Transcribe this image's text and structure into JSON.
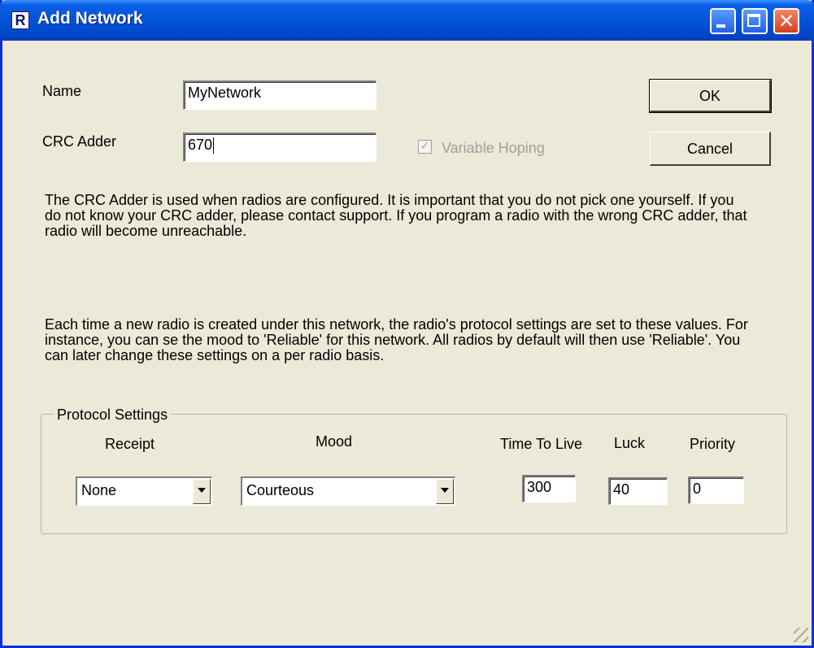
{
  "window": {
    "title": "Add Network",
    "icon_letter": "R"
  },
  "fields": {
    "name_label": "Name",
    "name_value": "MyNetwork",
    "crc_label": "CRC Adder",
    "crc_value": "670",
    "variable_hoping_label": "Variable Hoping",
    "variable_hoping_checked": true,
    "variable_hoping_enabled": false
  },
  "buttons": {
    "ok": "OK",
    "cancel": "Cancel"
  },
  "help": {
    "crc_paragraph": "The CRC Adder is used when radios are configured. It is important that you do not pick one yourself. If you do not know your CRC adder, please contact support. If you program a radio with the wrong CRC adder, that radio will become unreachable.",
    "protocol_paragraph": "Each time a new radio is created under this network, the radio's protocol settings are set to these values. For instance, you can se the mood to 'Reliable' for this network. All radios by default will then use 'Reliable'. You can later change these settings on a per radio basis."
  },
  "protocol": {
    "group_title": "Protocol Settings",
    "receipt_label": "Receipt",
    "receipt_value": "None",
    "mood_label": "Mood",
    "mood_value": "Courteous",
    "ttl_label": "Time To Live",
    "ttl_value": "300",
    "luck_label": "Luck",
    "luck_value": "40",
    "priority_label": "Priority",
    "priority_value": "0"
  },
  "icons": {
    "app": "app-r-icon",
    "minimize": "minimize-icon",
    "maximize": "maximize-icon",
    "close": "close-icon",
    "dropdown": "chevron-down-icon",
    "grip": "resize-grip-icon"
  }
}
